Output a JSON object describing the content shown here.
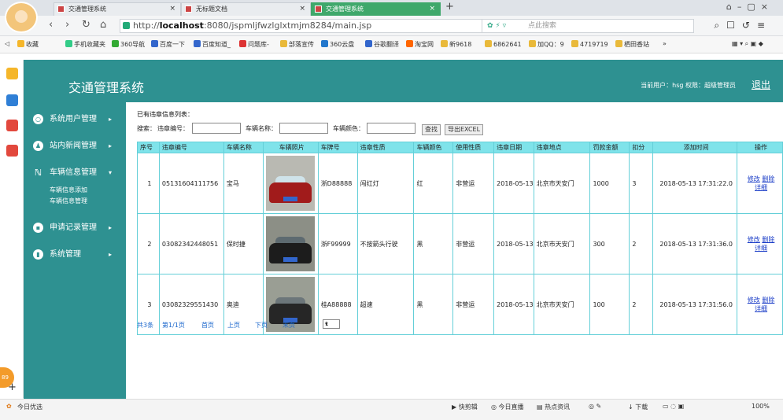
{
  "browser": {
    "tabs": [
      {
        "label": "交通管理系统"
      },
      {
        "label": "无标题文档"
      },
      {
        "label": "交通管理系统"
      }
    ],
    "url_prefix": "http://",
    "url_host": "localhost",
    "url_rest": ":8080/jspmljfwzlglxtmjm8284/main.jsp",
    "search_placeholder": "点此搜索",
    "bookmarks": [
      "收藏",
      "手机收藏夹",
      "360导航",
      "百度一下",
      "百度知道_",
      "问题库-",
      "部落宣传",
      "360云盘",
      "谷歌翻译",
      "淘宝网",
      "新9618",
      "6862641",
      "加QQ：9",
      "4719719",
      "栖田香站"
    ],
    "status_left": "今日优选",
    "status_items": [
      "快剪辑",
      "今日直播",
      "热点资讯",
      "下载",
      "100%"
    ]
  },
  "header": {
    "title": "交通管理系统",
    "user_info": "当前用户：hsg  权限：超级管理员",
    "logout": "退出"
  },
  "sidebar": {
    "menus": [
      {
        "label": "系统用户管理"
      },
      {
        "label": "站内新闻管理"
      },
      {
        "label": "车辆信息管理"
      },
      {
        "label": "申请记录管理"
      },
      {
        "label": "系统管理"
      }
    ],
    "submenus": [
      "车辆信息添加",
      "车辆信息管理"
    ]
  },
  "main": {
    "list_title": "已有违章信息列表：",
    "search": {
      "prefix": "搜索：",
      "label_violation_no": "违章编号：",
      "label_car_name": "车辆名称：",
      "label_car_color": "车辆颜色：",
      "find_button": "查找",
      "export_button": "导出EXCEL"
    },
    "columns": [
      "序号",
      "违章编号",
      "车辆名称",
      "车辆照片",
      "车牌号",
      "违章性质",
      "车辆颜色",
      "使用性质",
      "违章日期",
      "违章地点",
      "罚款金额",
      "扣分",
      "添加时间",
      "操作"
    ],
    "rows": [
      {
        "no": "1",
        "code": "05131604111756",
        "name": "宝马",
        "plate": "浙D88888",
        "nature": "闯红灯",
        "color": "红",
        "use": "非营运",
        "date": "2018-05-13",
        "place": "北京市天安门",
        "fine": "1000",
        "points": "3",
        "added": "2018-05-13 17:31:22.0"
      },
      {
        "no": "2",
        "code": "03082342448051",
        "name": "保时捷",
        "plate": "浙F99999",
        "nature": "不按箭头行驶",
        "color": "黑",
        "use": "非营运",
        "date": "2018-05-13",
        "place": "北京市天安门",
        "fine": "300",
        "points": "2",
        "added": "2018-05-13 17:31:36.0"
      },
      {
        "no": "3",
        "code": "03082329551430",
        "name": "奥迪",
        "plate": "桂A88888",
        "nature": "超速",
        "color": "黑",
        "use": "非营运",
        "date": "2018-05-13",
        "place": "北京市天安门",
        "fine": "100",
        "points": "2",
        "added": "2018-05-13 17:31:56.0"
      }
    ],
    "ops": {
      "edit": "修改",
      "delete": "删除",
      "detail": "详细"
    },
    "pager": {
      "total": "共3条",
      "page": "第1/1页",
      "first": "首页",
      "prev": "上页",
      "next": "下页",
      "last": "末页",
      "select": "1"
    }
  },
  "colors": {
    "brand": "#2e9191",
    "table_header": "#7fe3ea",
    "table_border": "#64cfd8",
    "link": "#1a3cc7"
  }
}
